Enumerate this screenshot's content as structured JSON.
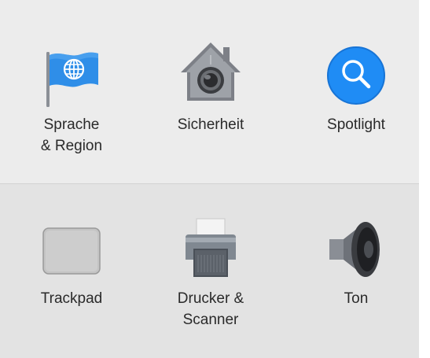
{
  "rows": [
    {
      "items": [
        {
          "label": "Sprache\n& Region",
          "icon": "flag-globe-icon"
        },
        {
          "label": "Sicherheit",
          "icon": "house-lock-icon"
        },
        {
          "label": "Spotlight",
          "icon": "magnifier-icon"
        }
      ]
    },
    {
      "items": [
        {
          "label": "Trackpad",
          "icon": "trackpad-icon"
        },
        {
          "label": "Drucker &\nScanner",
          "icon": "printer-icon"
        },
        {
          "label": "Ton",
          "icon": "speaker-icon"
        }
      ]
    }
  ],
  "colors": {
    "top_background": "#ececec",
    "bottom_background": "#e3e3e3",
    "spotlight_blue": "#1f8cf5",
    "flag_blue": "#2f8ee8"
  }
}
